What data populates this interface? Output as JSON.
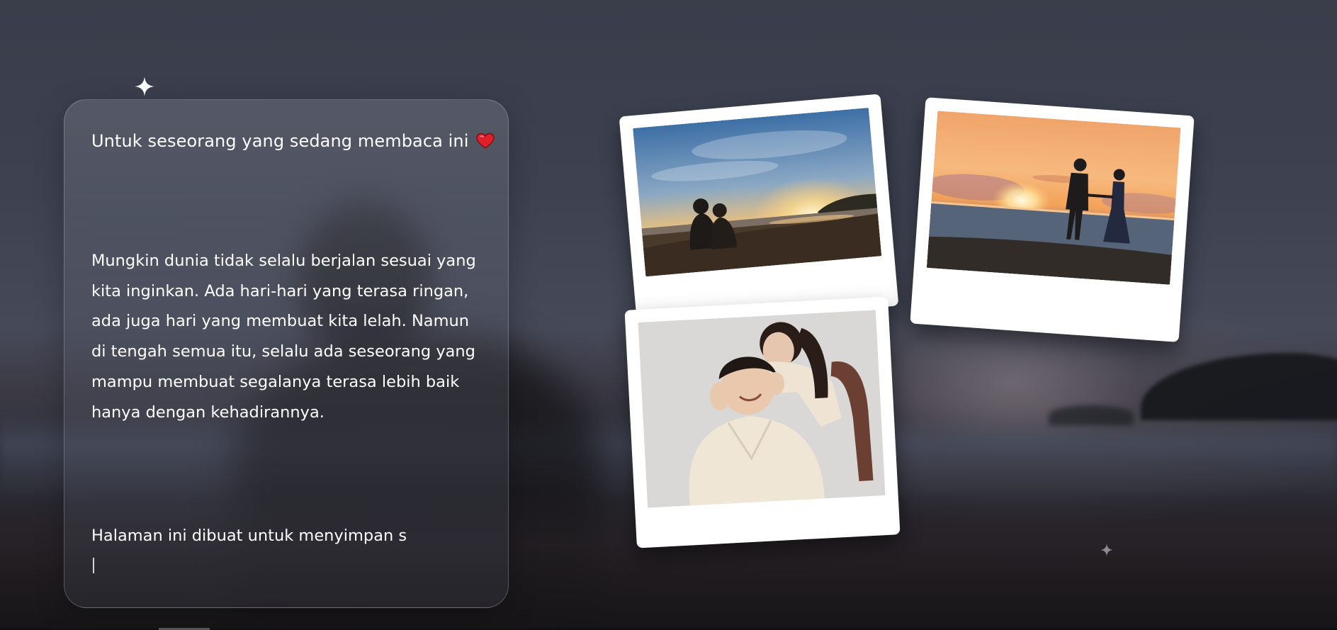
{
  "card": {
    "title": "Untuk seseorang yang sedang membaca ini",
    "title_icon": "red-heart-icon",
    "body": "Mungkin dunia tidak selalu berjalan sesuai yang kita inginkan. Ada hari-hari yang terasa ringan, ada juga hari yang membuat kita lelah. Namun di tengah semua itu, selalu ada seseorang yang mampu membuat segalanya terasa lebih baik hanya dengan kehadirannya.",
    "typing_text": "Halaman ini dibuat untuk menyimpan s"
  },
  "photos": [
    {
      "subject": "couple-sitting-at-sunset-beach"
    },
    {
      "subject": "couple-holding-hands-at-sunset-beach"
    },
    {
      "subject": "smiling-couple-in-cream-sweaters"
    }
  ],
  "decorations": {
    "sparkle_icon": "four-point-star-icon"
  },
  "colors": {
    "heart": "#e0202a",
    "card_text": "#ffffff",
    "polaroid_frame": "#ffffff"
  }
}
